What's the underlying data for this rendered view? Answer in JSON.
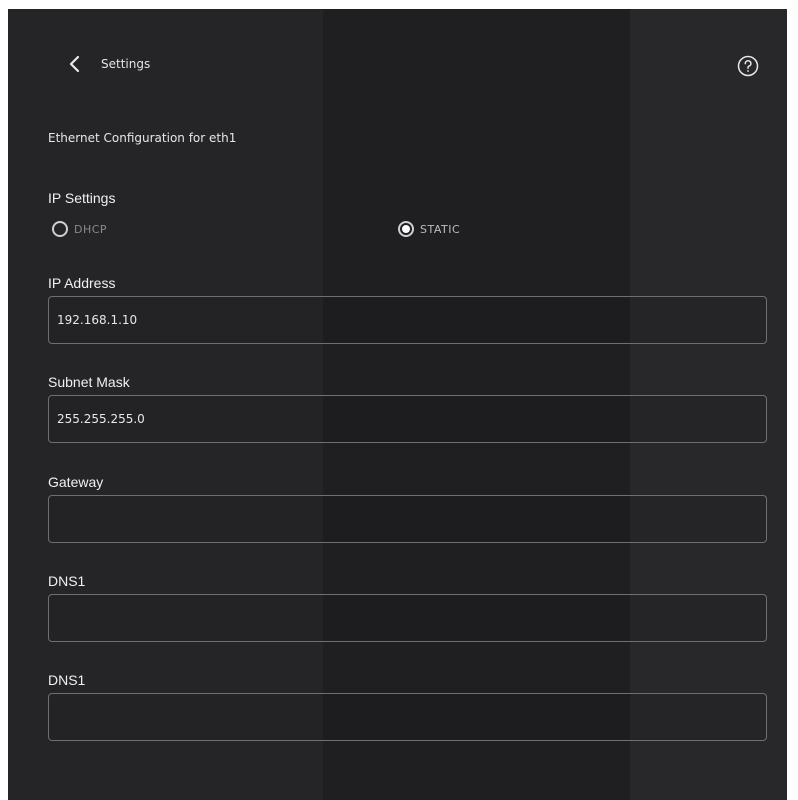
{
  "header": {
    "title": "Settings",
    "back_icon": "chevron-left-icon",
    "help_icon": "help-circle-icon"
  },
  "page_title": "Ethernet Configuration for eth1",
  "ip_settings": {
    "label": "IP Settings",
    "options": [
      {
        "label": "DHCP",
        "selected": false
      },
      {
        "label": "STATIC",
        "selected": true
      }
    ]
  },
  "fields": {
    "ip_address": {
      "label": "IP Address",
      "value": "192.168.1.10"
    },
    "subnet_mask": {
      "label": "Subnet Mask",
      "value": "255.255.255.0"
    },
    "gateway": {
      "label": "Gateway",
      "value": ""
    },
    "dns1": {
      "label": "DNS1",
      "value": ""
    },
    "dns2": {
      "label": "DNS1",
      "value": ""
    }
  },
  "colors": {
    "background": "#252527",
    "text": "#f0f0f2",
    "input_border": "#6f6f73"
  }
}
